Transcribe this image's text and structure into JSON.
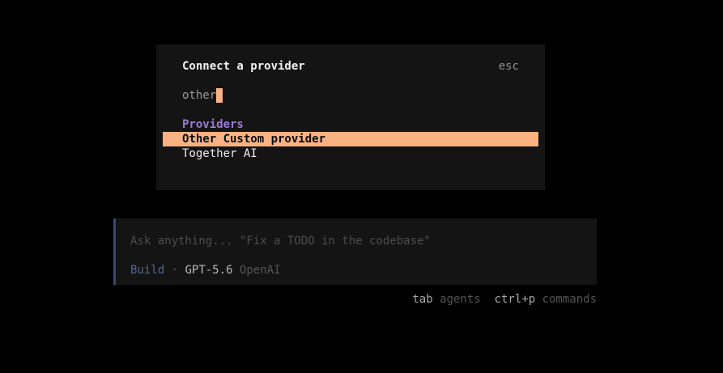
{
  "dialog": {
    "title": "Connect a provider",
    "esc_label": "esc",
    "search_value": "other",
    "group_label": "Providers",
    "options": [
      {
        "label": "Other Custom provider",
        "selected": true
      },
      {
        "label": "Together AI",
        "selected": false
      }
    ]
  },
  "prompt": {
    "placeholder": "Ask anything... \"Fix a TODO in the codebase\"",
    "agent": "Build",
    "separator": "·",
    "model": "GPT-5.6",
    "provider": "OpenAI"
  },
  "hints": [
    {
      "key": "tab",
      "label": "agents"
    },
    {
      "key": "ctrl+p",
      "label": "commands"
    }
  ],
  "colors": {
    "accent": "#fab283",
    "group_label": "#9d7cd8",
    "agent": "#4f6a8f",
    "background": "#000000",
    "panel": "#141414"
  }
}
